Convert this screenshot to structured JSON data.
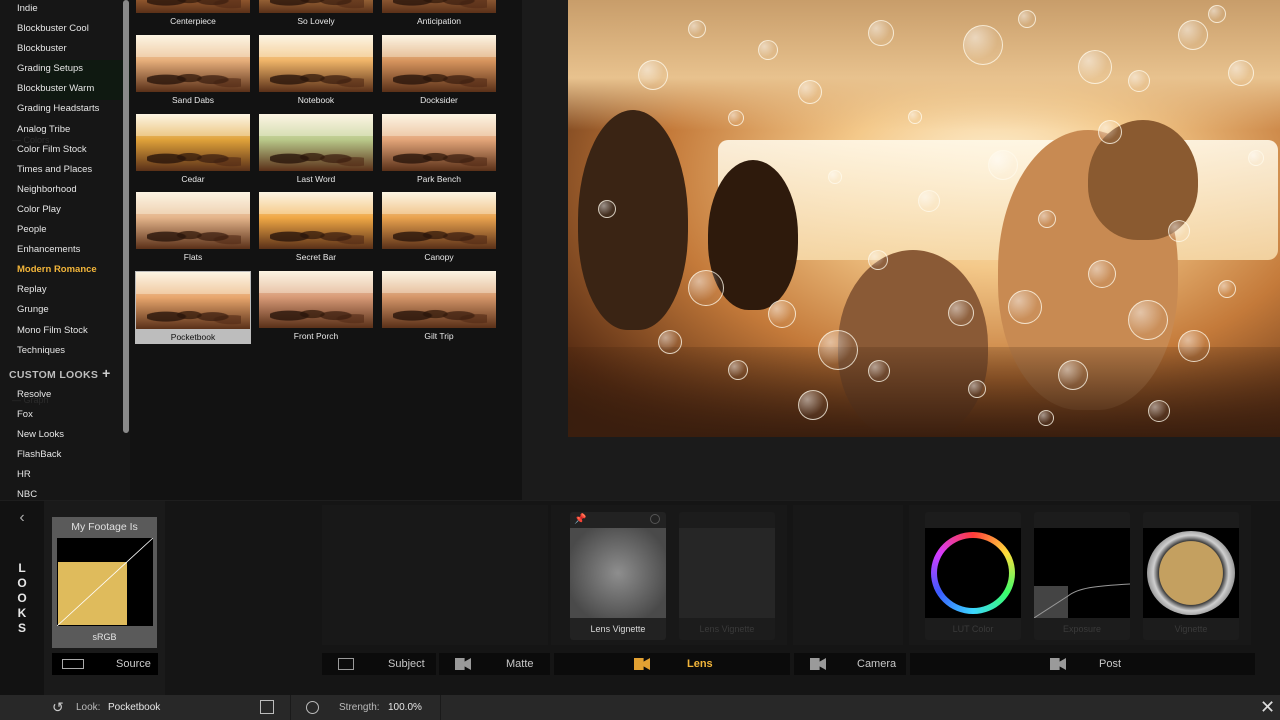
{
  "sidebar": {
    "categories": [
      "Indie",
      "Blockbuster Cool",
      "Blockbuster",
      "Grading Setups",
      "Blockbuster Warm",
      "Grading Headstarts",
      "Analog Tribe",
      "Color Film Stock",
      "Times and Places",
      "Neighborhood",
      "Color Play",
      "People",
      "Enhancements",
      "Modern Romance",
      "Replay",
      "Grunge",
      "Mono Film Stock",
      "Techniques"
    ],
    "selected_category": "Modern Romance",
    "custom_header": "CUSTOM LOOKS",
    "custom_items": [
      "Resolve",
      "Fox",
      "New Looks",
      "FlashBack",
      "HR",
      "NBC"
    ]
  },
  "grid": {
    "looks": [
      {
        "label": "Centerpiece",
        "tint": "#d88a4a"
      },
      {
        "label": "So Lovely",
        "tint": "#e4a35c"
      },
      {
        "label": "Anticipation",
        "tint": "#c98a54"
      },
      {
        "label": "Sand Dabs",
        "tint": "#e6ae7a"
      },
      {
        "label": "Notebook",
        "tint": "#efb468"
      },
      {
        "label": "Docksider",
        "tint": "#d7955e"
      },
      {
        "label": "Cedar",
        "tint": "#e0a23a"
      },
      {
        "label": "Last Word",
        "tint": "#b9c98a"
      },
      {
        "label": "Park Bench",
        "tint": "#e3a579"
      },
      {
        "label": "Flats",
        "tint": "#e4b48a"
      },
      {
        "label": "Secret Bar",
        "tint": "#f0a845"
      },
      {
        "label": "Canopy",
        "tint": "#e9a24e"
      },
      {
        "label": "Pocketbook",
        "tint": "#e7a56c"
      },
      {
        "label": "Front Porch",
        "tint": "#d99b78"
      },
      {
        "label": "Gilt Trip",
        "tint": "#d6976a"
      }
    ],
    "selected_look": "Pocketbook"
  },
  "source": {
    "tab_letters": [
      "L",
      "O",
      "O",
      "K",
      "S"
    ],
    "footage_title": "My Footage Is",
    "footage_space": "sRGB",
    "source_tab": "Source"
  },
  "tools": {
    "lens_vignette": "Lens Vignette",
    "lens_dim": "Lens Vignette",
    "post_tools": [
      "LUT Color",
      "Exposure",
      "Vignette"
    ],
    "tabs": {
      "subject": "Subject",
      "matte": "Matte",
      "lens": "Lens",
      "camera": "Camera",
      "post": "Post"
    },
    "active_tab": "Lens"
  },
  "status": {
    "look_label": "Look:",
    "look_value": "Pocketbook",
    "strength_label": "Strength:",
    "strength_value": "100.0%"
  },
  "colors": {
    "accent": "#f2b53a",
    "panel": "#151515",
    "footage_fill": "#dfbb5c"
  },
  "icons": [
    "undo-icon",
    "save-icon",
    "reset-icon",
    "close-icon",
    "back-arrow-icon",
    "pin-icon",
    "film-icon",
    "person-icon",
    "camera-icon"
  ]
}
